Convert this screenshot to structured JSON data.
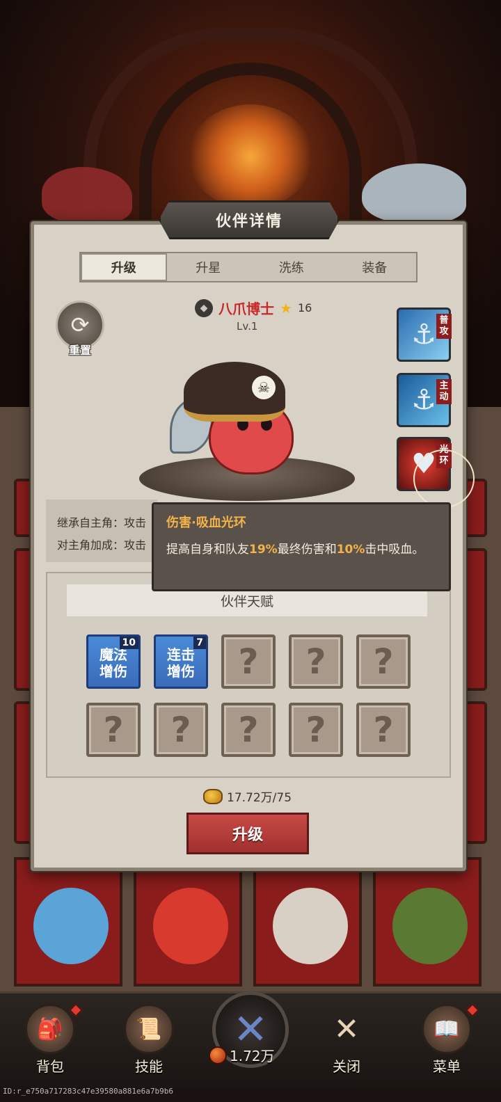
{
  "modal": {
    "title": "伙伴详情",
    "tabs": [
      "升级",
      "升星",
      "洗练",
      "装备"
    ],
    "active_tab": "升级"
  },
  "reset": {
    "label": "重置",
    "icon": "refresh-icon"
  },
  "partner": {
    "name": "八爪博士",
    "stars": "16",
    "level": "Lv.1",
    "name_color": "#c8282a"
  },
  "skills": [
    {
      "tag_top": "普",
      "tag_bottom": "攻",
      "icon": "anchor-icon"
    },
    {
      "tag_top": "主",
      "tag_bottom": "动",
      "icon": "anchor-wave-icon"
    },
    {
      "tag_top": "光",
      "tag_bottom": "环",
      "icon": "heart-aura-icon"
    }
  ],
  "inherit": {
    "line1": "继承自主角：攻击",
    "line2": "对主角加成：攻击"
  },
  "tooltip": {
    "title": "伤害·吸血光环",
    "body_prefix": "提高自身和队友",
    "value1": "19%",
    "body_mid": "最终伤害和",
    "value2": "10%",
    "body_suffix": "击中吸血。"
  },
  "talents": {
    "header": "伙伴天赋",
    "slots": [
      {
        "label": "魔法\n增伤",
        "count": "10",
        "unlocked": true
      },
      {
        "label": "连击\n增伤",
        "count": "7",
        "unlocked": true
      },
      {
        "label": "?",
        "unlocked": false
      },
      {
        "label": "?",
        "unlocked": false
      },
      {
        "label": "?",
        "unlocked": false
      },
      {
        "label": "?",
        "unlocked": false
      },
      {
        "label": "?",
        "unlocked": false
      },
      {
        "label": "?",
        "unlocked": false
      },
      {
        "label": "?",
        "unlocked": false
      },
      {
        "label": "?",
        "unlocked": false
      }
    ]
  },
  "cost": {
    "text": "17.72万/75"
  },
  "upgrade_button": "升级",
  "bottom_nav": {
    "items": [
      {
        "label": "背包",
        "icon": "backpack-icon"
      },
      {
        "label": "技能",
        "icon": "scroll-icon"
      },
      {
        "label": "关闭",
        "icon": "close-icon"
      },
      {
        "label": "菜单",
        "icon": "book-icon"
      }
    ],
    "currency": "1.72万"
  },
  "debug_id": "ID:r_e750a717283c47e39580a881e6a7b9b6"
}
